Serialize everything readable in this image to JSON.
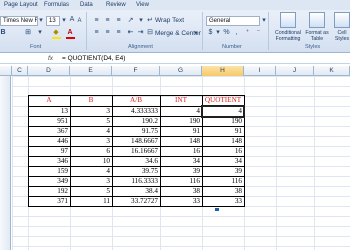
{
  "ribbon": {
    "tabs": [
      "Page Layout",
      "Formulas",
      "Data",
      "Review",
      "View"
    ],
    "font_name": "Times New Rom",
    "font_size": "13",
    "wrap_text": "Wrap Text",
    "merge_center": "Merge & Center",
    "number_format": "General",
    "groups": {
      "font": "Font",
      "alignment": "Alignment",
      "number": "Number",
      "styles": "Styles"
    },
    "buttons": {
      "conditional_formatting": "Conditional Formatting",
      "format_as_table": "Format as Table",
      "cell_styles": "Cell Styles"
    },
    "number_symbols": {
      "currency": "$",
      "percent": "%",
      "comma": ","
    },
    "bold": "B"
  },
  "formula_bar": {
    "fx": "fx",
    "formula": "= QUOTIENT(D4, E4)"
  },
  "grid": {
    "columns": [
      "C",
      "D",
      "E",
      "F",
      "G",
      "H",
      "I",
      "J",
      "K"
    ],
    "selected_column": "H",
    "headers": {
      "a": "A",
      "b": "B",
      "ab": "A/B",
      "int": "INT",
      "quotient": "QUOTIENT"
    },
    "rows": [
      {
        "a": "13",
        "b": "3",
        "ab": "4.333333",
        "int": "4",
        "q": "4"
      },
      {
        "a": "951",
        "b": "5",
        "ab": "190.2",
        "int": "190",
        "q": "190"
      },
      {
        "a": "367",
        "b": "4",
        "ab": "91.75",
        "int": "91",
        "q": "91"
      },
      {
        "a": "446",
        "b": "3",
        "ab": "148.6667",
        "int": "148",
        "q": "148"
      },
      {
        "a": "97",
        "b": "6",
        "ab": "16.16667",
        "int": "16",
        "q": "16"
      },
      {
        "a": "346",
        "b": "10",
        "ab": "34.6",
        "int": "34",
        "q": "34"
      },
      {
        "a": "159",
        "b": "4",
        "ab": "39.75",
        "int": "39",
        "q": "39"
      },
      {
        "a": "349",
        "b": "3",
        "ab": "116.3333",
        "int": "116",
        "q": "116"
      },
      {
        "a": "192",
        "b": "5",
        "ab": "38.4",
        "int": "38",
        "q": "38"
      },
      {
        "a": "371",
        "b": "11",
        "ab": "33.72727",
        "int": "33",
        "q": "33"
      }
    ]
  }
}
